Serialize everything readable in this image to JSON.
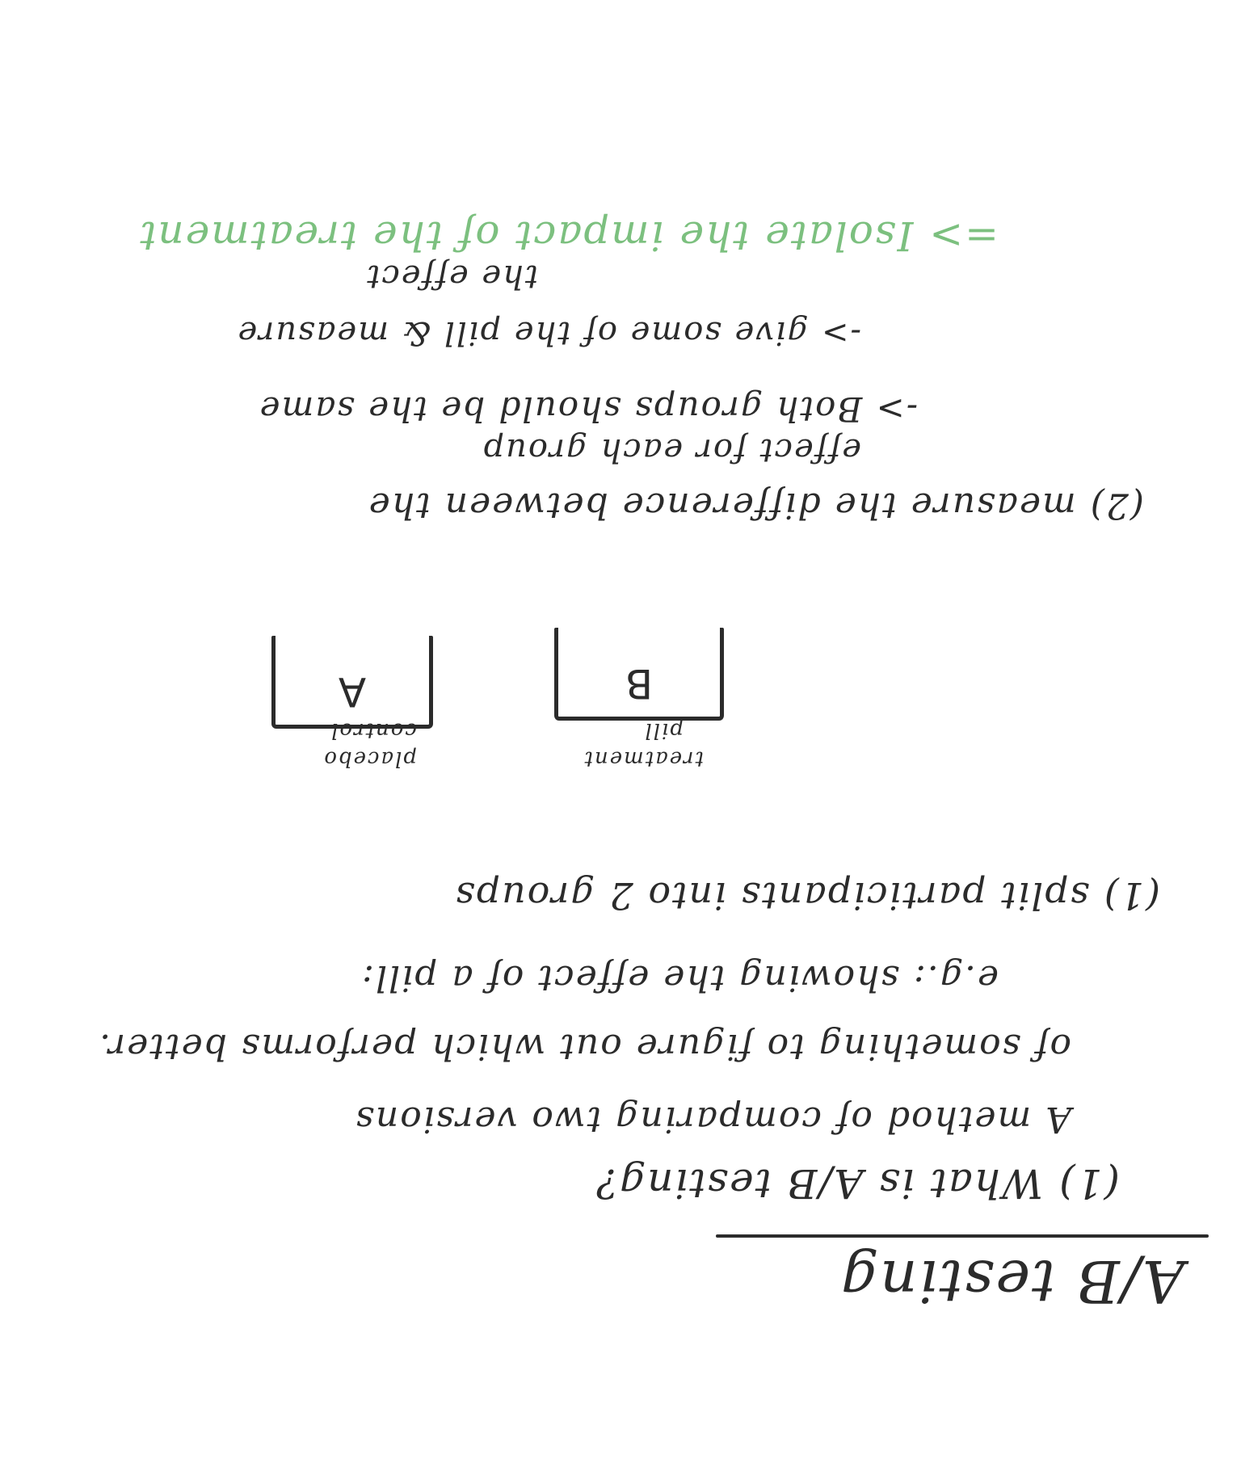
{
  "notes": {
    "heading": "A/B testing",
    "question": "(1) What is A/B testing?",
    "lines": [
      "A method of comparing two versions",
      "of something to figure out which performs better.",
      "e.g.: showing the effect of a pill:",
      "(1) split participants into 2 groups"
    ],
    "box_a_letter": "A",
    "box_a_caption_1": "placebo",
    "box_a_caption_2": "control",
    "box_b_letter": "B",
    "box_b_caption_1": "treatment",
    "box_b_caption_2": "pill",
    "lines2": [
      "(2) measure the difference between the",
      "effect for each group",
      "-> give some of the pill & measure",
      "the effect",
      "-> Both groups should be the same",
      "=> Isolate the impact of the treatment"
    ]
  },
  "colors": {
    "ink": "#2b2b2b",
    "highlight": "#7cc07f"
  }
}
